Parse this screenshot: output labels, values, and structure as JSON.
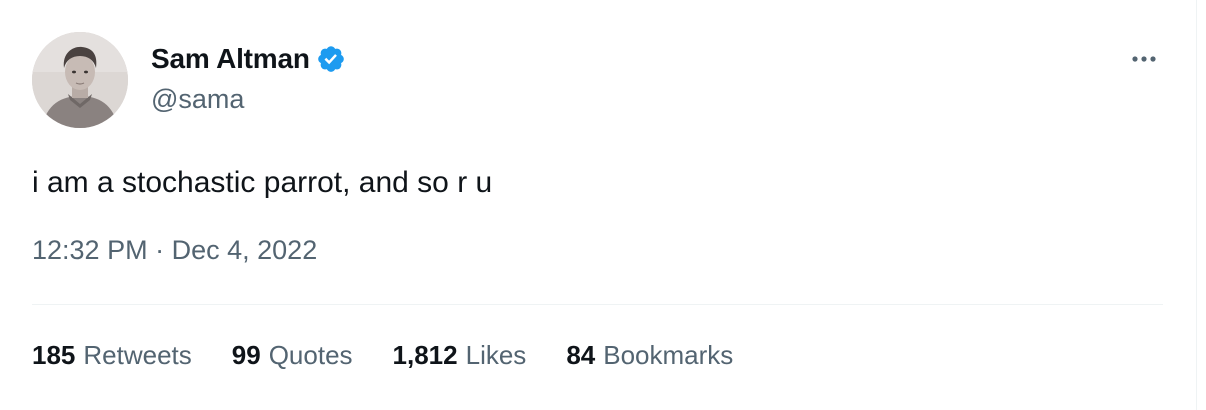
{
  "author": {
    "display_name": "Sam Altman",
    "handle": "@sama",
    "verified": true,
    "avatar_icon": "profile-photo"
  },
  "tweet": {
    "text": "i am a stochastic parrot, and so r u",
    "time": "12:32 PM",
    "separator": "·",
    "date": "Dec 4, 2022"
  },
  "stats": [
    {
      "count": "185",
      "label": "Retweets"
    },
    {
      "count": "99",
      "label": "Quotes"
    },
    {
      "count": "1,812",
      "label": "Likes"
    },
    {
      "count": "84",
      "label": "Bookmarks"
    }
  ],
  "colors": {
    "text_primary": "#0f1419",
    "text_secondary": "#536471",
    "verified_blue": "#1d9bf0",
    "divider": "#eff3f4"
  },
  "icons": {
    "verified": "verified-badge-icon",
    "more": "more-options-icon"
  }
}
